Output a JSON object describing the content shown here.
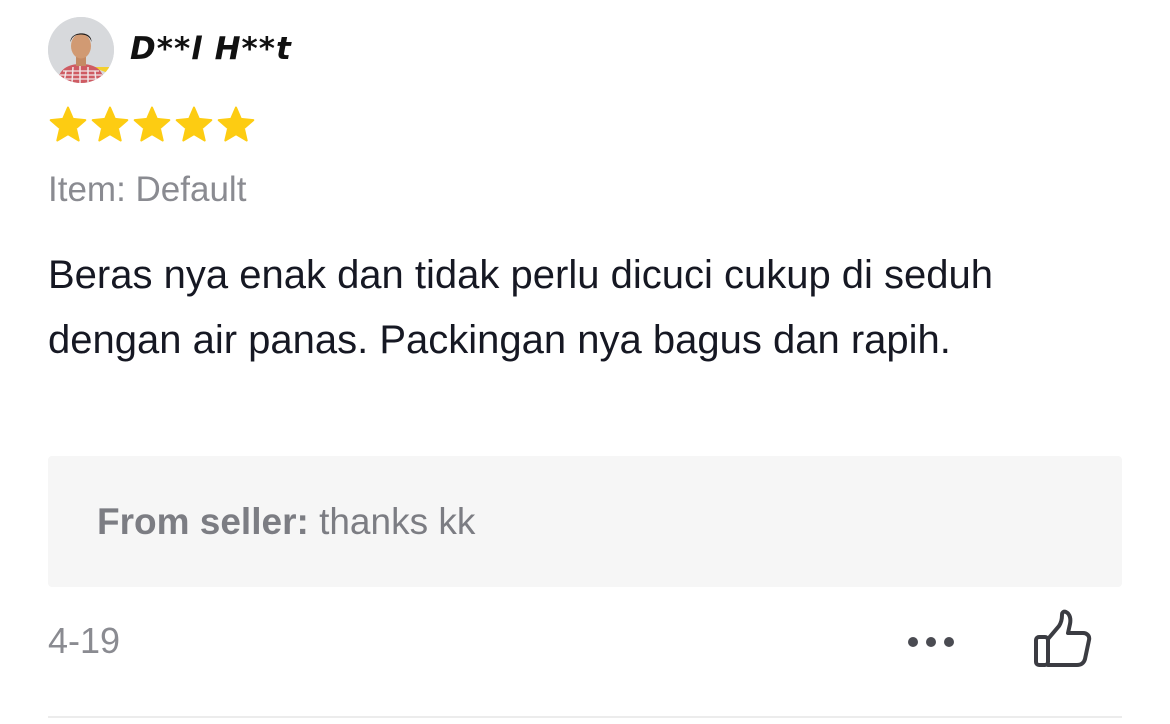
{
  "review": {
    "user": {
      "name": "D**l H**t",
      "avatar_icon": "user-avatar-photo"
    },
    "rating": 5,
    "rating_max": 5,
    "star_color": "#fdcc12",
    "variant": "Item: Default",
    "text": "Beras nya enak dan tidak perlu dicuci cukup di seduh dengan air panas. Packingan nya bagus dan rapih.",
    "seller_reply": {
      "label": "From seller:",
      "text": " thanks kk"
    },
    "date": "4-19",
    "actions": {
      "more_icon": "more-dots-icon",
      "like_icon": "thumbs-up-icon"
    }
  }
}
